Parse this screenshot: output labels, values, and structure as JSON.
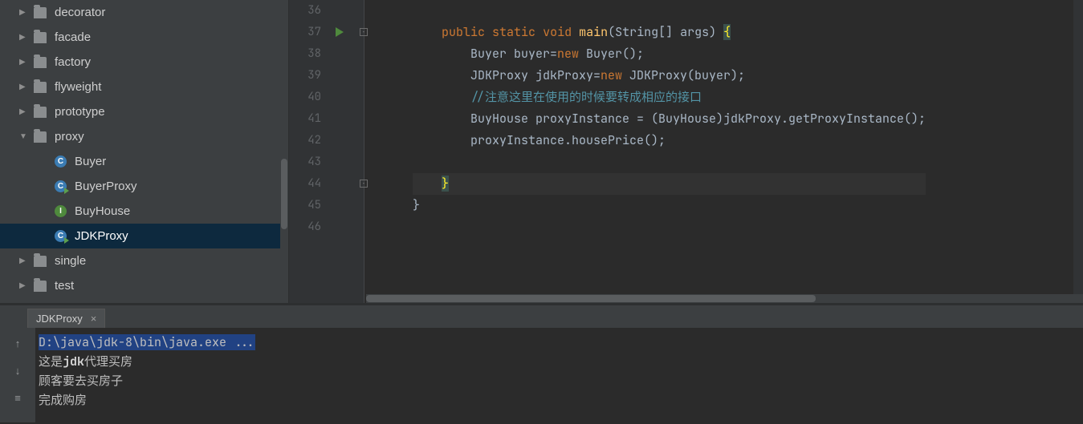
{
  "tree": {
    "items": [
      {
        "label": "decorator",
        "type": "folder",
        "arrow": "▶",
        "indent": 1
      },
      {
        "label": "facade",
        "type": "folder",
        "arrow": "▶",
        "indent": 1
      },
      {
        "label": "factory",
        "type": "folder",
        "arrow": "▶",
        "indent": 1
      },
      {
        "label": "flyweight",
        "type": "folder",
        "arrow": "▶",
        "indent": 1
      },
      {
        "label": "prototype",
        "type": "folder",
        "arrow": "▶",
        "indent": 1
      },
      {
        "label": "proxy",
        "type": "folder",
        "arrow": "▼",
        "indent": 1
      },
      {
        "label": "Buyer",
        "type": "class",
        "arrow": "",
        "indent": 2
      },
      {
        "label": "BuyerProxy",
        "type": "class_run",
        "arrow": "",
        "indent": 2
      },
      {
        "label": "BuyHouse",
        "type": "interface",
        "arrow": "",
        "indent": 2
      },
      {
        "label": "JDKProxy",
        "type": "class_run",
        "arrow": "",
        "indent": 2,
        "selected": true
      },
      {
        "label": "single",
        "type": "folder",
        "arrow": "▶",
        "indent": 1
      },
      {
        "label": "test",
        "type": "folder",
        "arrow": "▶",
        "indent": 1
      }
    ]
  },
  "editor": {
    "line_numbers": [
      "36",
      "37",
      "38",
      "39",
      "40",
      "41",
      "42",
      "43",
      "44",
      "45",
      "46"
    ],
    "code": {
      "l37_kw1": "public",
      "l37_kw2": "static",
      "l37_kw3": "void",
      "l37_fn": "main",
      "l37_rest": "(String[] args) ",
      "l37_brace": "{",
      "l38_a": "Buyer buyer=",
      "l38_new": "new",
      "l38_b": " Buyer();",
      "l39_a": "JDKProxy jdkProxy=",
      "l39_new": "new",
      "l39_b": " JDKProxy(buyer);",
      "l40": "//注意这里在使用的时候要转成相应的接口",
      "l41": "BuyHouse proxyInstance = (BuyHouse)jdkProxy.getProxyInstance();",
      "l42": "proxyInstance.housePrice();",
      "l44": "}",
      "l45": "}"
    }
  },
  "run_tab": {
    "label": "JDKProxy",
    "close": "×"
  },
  "console": {
    "lines": [
      "D:\\java\\jdk-8\\bin\\java.exe ...",
      "这是jdk代理买房",
      "顾客要去买房子",
      "完成购房"
    ]
  },
  "icons": {
    "c": "C",
    "i": "I"
  }
}
